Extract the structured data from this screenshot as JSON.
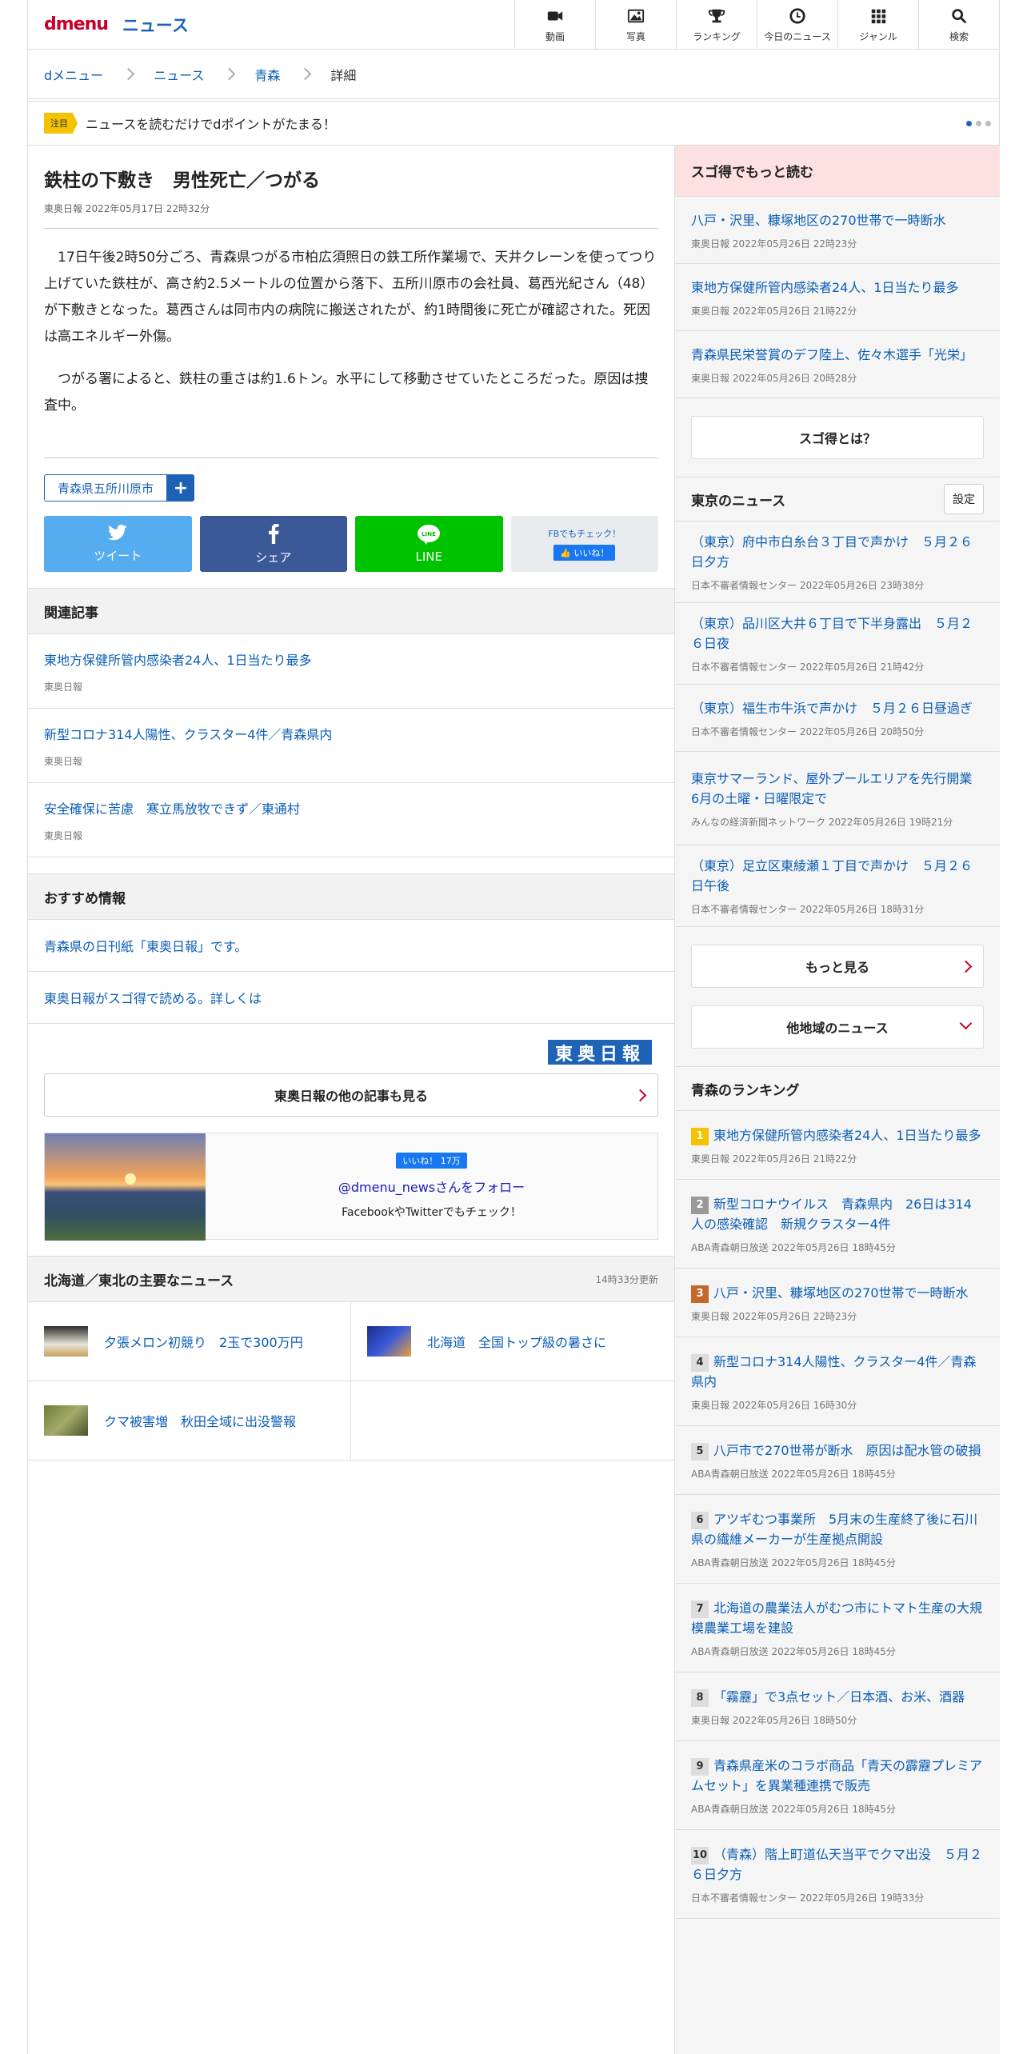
{
  "header": {
    "logo_d": "dmenu",
    "logo_news": "ニュース",
    "nav": [
      {
        "icon": "video-icon",
        "label": "動画"
      },
      {
        "icon": "photo-icon",
        "label": "写真"
      },
      {
        "icon": "trophy-icon",
        "label": "ランキング"
      },
      {
        "icon": "clock-icon",
        "label": "今日のニュース"
      },
      {
        "icon": "grid-icon",
        "label": "ジャンル"
      },
      {
        "icon": "search-icon",
        "label": "検索"
      }
    ]
  },
  "breadcrumb": [
    "dメニュー",
    "ニュース",
    "青森",
    "詳細"
  ],
  "notice": {
    "tag": "注目",
    "text": "ニュースを読むだけでdポイントがたまる！"
  },
  "article": {
    "title": "鉄柱の下敷き　男性死亡／つがる",
    "meta": "東奥日報 2022年05月17日 22時32分",
    "p1": "17日午後2時50分ごろ、青森県つがる市柏広須照日の鉄工所作業場で、天井クレーンを使ってつり上げていた鉄柱が、高さ約2.5メートルの位置から落下、五所川原市の会社員、葛西光紀さん（48）が下敷きとなった。葛西さんは同市内の病院に搬送されたが、約1時間後に死亡が確認された。死因は高エネルギー外傷。",
    "p2": "つがる署によると、鉄柱の重さは約1.6トン。水平にして移動させていたところだった。原因は捜査中。",
    "keyword": "青森県五所川原市",
    "plus": "+"
  },
  "share": {
    "tweet": "ツイート",
    "share": "シェア",
    "line": "LINE",
    "fb_check": "FBでもチェック！",
    "like": "いいね！",
    "line_logo": "LINE"
  },
  "related": {
    "title": "関連記事",
    "items": [
      {
        "t": "東地方保健所管内感染者24人、1日当たり最多",
        "s": "東奥日報"
      },
      {
        "t": "新型コロナ314人陽性、クラスター4件／青森県内",
        "s": "東奥日報"
      },
      {
        "t": "安全確保に苦慮　寒立馬放牧できず／東通村",
        "s": "東奥日報"
      }
    ]
  },
  "recommend": {
    "title": "おすすめ情報",
    "items": [
      "青森県の日刊紙「東奥日報」です。",
      "東奥日報がスゴ得で読める。詳しくは"
    ],
    "logo": "東奥日報",
    "more": "東奥日報の他の記事も見る"
  },
  "follow": {
    "like": "いいね！ 17万",
    "handle": "@dmenu_newsさんをフォロー",
    "caption": "FacebookやTwitterでもチェック！"
  },
  "regional": {
    "title": "北海道／東北の主要なニュース",
    "updated": "14時33分更新",
    "items": [
      "夕張メロン初競り　2玉で300万円",
      "北海道　全国トップ級の暑さに",
      "クマ被害増　秋田全域に出没警報"
    ]
  },
  "sugo": {
    "title": "スゴ得でもっと読む",
    "items": [
      {
        "t": "八戸・沢里、糠塚地区の270世帯で一時断水",
        "s": "東奥日報  2022年05月26日 22時23分"
      },
      {
        "t": "東地方保健所管内感染者24人、1日当たり最多",
        "s": "東奥日報  2022年05月26日 21時22分"
      },
      {
        "t": "青森県民栄誉賞のデフ陸上、佐々木選手「光栄」",
        "s": "東奥日報  2022年05月26日 20時28分"
      }
    ],
    "about": "スゴ得とは？"
  },
  "tokyo": {
    "title": "東京のニュース",
    "setting": "設定",
    "items": [
      {
        "t": "（東京）府中市白糸台３丁目で声かけ　５月２６日夕方",
        "s": "日本不審者情報センター  2022年05月26日  23時38分"
      },
      {
        "t": "（東京）品川区大井６丁目で下半身露出　５月２６日夜",
        "s": "日本不審者情報センター  2022年05月26日  21時42分"
      },
      {
        "t": "（東京）福生市牛浜で声かけ　５月２６日昼過ぎ",
        "s": "日本不審者情報センター  2022年05月26日  20時50分"
      },
      {
        "t": "東京サマーランド、屋外プールエリアを先行開業 6月の土曜・日曜限定で",
        "s": "みんなの経済新聞ネットワーク  2022年05月26日  19時21分"
      },
      {
        "t": "（東京）足立区東綾瀬１丁目で声かけ　５月２６日午後",
        "s": "日本不審者情報センター  2022年05月26日  18時31分"
      }
    ],
    "more": "もっと見る",
    "other": "他地域のニュース"
  },
  "ranking": {
    "title": "青森のランキング",
    "items": [
      {
        "n": "1",
        "t": "東地方保健所管内感染者24人、1日当たり最多",
        "s": "東奥日報  2022年05月26日 21時22分"
      },
      {
        "n": "2",
        "t": "新型コロナウイルス　青森県内　26日は314人の感染確認　新規クラスター4件",
        "s": "ABA青森朝日放送  2022年05月26日 18時45分"
      },
      {
        "n": "3",
        "t": "八戸・沢里、糠塚地区の270世帯で一時断水",
        "s": "東奥日報  2022年05月26日 22時23分"
      },
      {
        "n": "4",
        "t": "新型コロナ314人陽性、クラスター4件／青森県内",
        "s": "東奥日報  2022年05月26日 16時30分"
      },
      {
        "n": "5",
        "t": "八戸市で270世帯が断水　原因は配水管の破損",
        "s": "ABA青森朝日放送  2022年05月26日 18時45分"
      },
      {
        "n": "6",
        "t": "アツギむつ事業所　5月末の生産終了後に石川県の繊維メーカーが生産拠点開設",
        "s": "ABA青森朝日放送  2022年05月26日 18時45分"
      },
      {
        "n": "7",
        "t": "北海道の農業法人がむつ市にトマト生産の大規模農業工場を建設",
        "s": "ABA青森朝日放送  2022年05月26日 18時45分"
      },
      {
        "n": "8",
        "t": "「霧靂」で3点セット／日本酒、お米、酒器",
        "s": "東奥日報  2022年05月26日 18時50分"
      },
      {
        "n": "9",
        "t": "青森県産米のコラボ商品「青天の霹靂プレミアムセット」を異業種連携で販売",
        "s": "ABA青森朝日放送  2022年05月26日 18時45分"
      },
      {
        "n": "10",
        "t": "（青森）階上町道仏天当平でクマ出没　５月２６日夕方",
        "s": "日本不審者情報センター  2022年05月26日 19時33分"
      }
    ]
  }
}
